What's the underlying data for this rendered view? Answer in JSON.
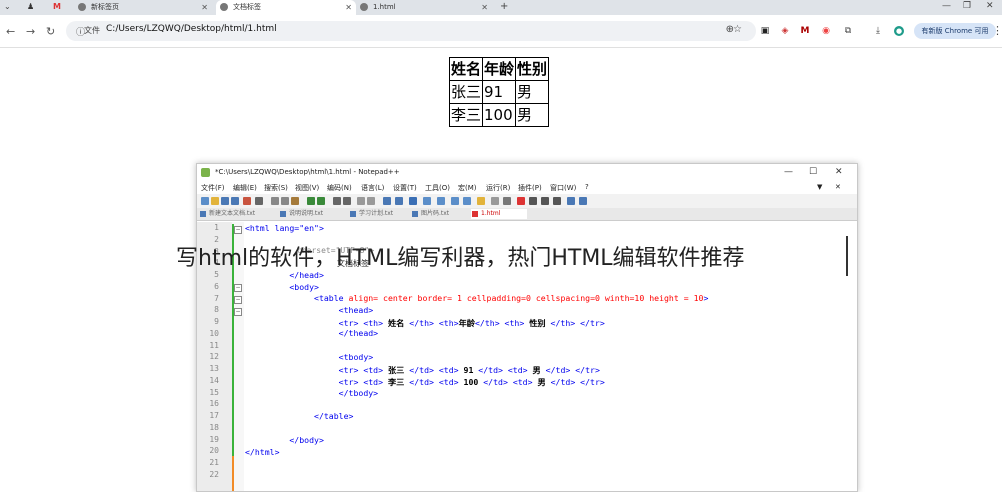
{
  "browser": {
    "tabs": [
      {
        "label": "新标签页"
      },
      {
        "label": "文档标签",
        "active": true
      },
      {
        "label": "1.html"
      }
    ],
    "address": {
      "info_label": "文件",
      "url": "C:/Users/LZQWQ/Desktop/html/1.html"
    },
    "update_button": "有新版 Chrome 可用"
  },
  "page": {
    "table": {
      "headers": [
        "姓名",
        "年龄",
        "性别"
      ],
      "rows": [
        [
          "张三",
          "91",
          "男"
        ],
        [
          "李三",
          "100",
          "男"
        ]
      ]
    }
  },
  "screenshot": {
    "title": "*C:\\Users\\LZQWQ\\Desktop\\html\\1.html - Notepad++",
    "menu": [
      "文件(F)",
      "编辑(E)",
      "搜索(S)",
      "视图(V)",
      "编码(N)",
      "语言(L)",
      "设置(T)",
      "工具(O)",
      "宏(M)",
      "运行(R)",
      "插件(P)",
      "窗口(W)",
      "?"
    ],
    "file_tabs": [
      "新建文本文档.txt",
      "说明说明.txt",
      "学习计划.txt",
      "图片码.txt",
      "1.html"
    ],
    "line_numbers": [
      "1",
      "2",
      "3",
      "4",
      "5",
      "6",
      "7",
      "8",
      "9",
      "10",
      "11",
      "12",
      "13",
      "14",
      "15",
      "16",
      "17",
      "18",
      "19",
      "20",
      "21",
      "22"
    ],
    "code": {
      "l1": "<html lang=\"en\">",
      "l4": "</head>",
      "l5": "<body>",
      "l6a": "<table ",
      "l6b": "align= center border= 1 cellpadding=0 cellspacing=0 winth=10 height = 10",
      "l6c": ">",
      "l7": "<thead>",
      "l8a": "<tr> <th> ",
      "l8b": "姓名",
      "l8c": " </th> <th>",
      "l8d": "年龄",
      "l8e": "</th> <th> ",
      "l8f": "性别",
      "l8g": " </th> </tr>",
      "l9": "</thead>",
      "l11": "<tbody>",
      "l12a": "<tr> <td> ",
      "l12b": "张三",
      "l12c": " </td> <td> ",
      "l12d": "91",
      "l12e": " </td> <td> ",
      "l12f": "男",
      "l12g": " </td> </tr>",
      "l13a": "<tr> <td> ",
      "l13b": "李三",
      "l13c": " </td> <td> ",
      "l13d": "100",
      "l13e": " </td> <td> ",
      "l13f": "男",
      "l13g": " </td> </tr>",
      "l14": "</tbody>",
      "l16": "</table>",
      "l18": "</body>",
      "l19": "</html>",
      "ghost_title": "文档标签"
    }
  },
  "overlay_caption": "写html的软件，HTML编写利器，热门HTML编辑软件推荐",
  "colors": {
    "tag": "#0000ee",
    "attr": "#ff0000",
    "tabstrip": "#dfe3e8",
    "gutter_green": "#3bb33b"
  }
}
